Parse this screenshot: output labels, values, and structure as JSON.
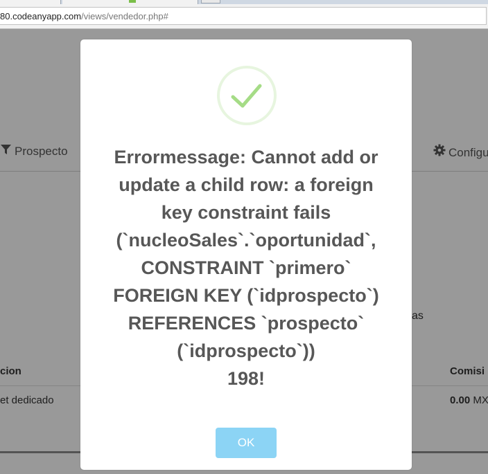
{
  "browser": {
    "url_host": "80.codeanyapp.com",
    "url_path": "/views/vendedor.php#"
  },
  "nav": {
    "items": [
      {
        "label": "Prospecto",
        "icon": "filter-icon"
      },
      {
        "label": "Configu",
        "icon": "gear-icon"
      }
    ]
  },
  "page": {
    "side_text": "as",
    "table": {
      "headers": [
        "cion",
        "Comisi"
      ],
      "row": {
        "col1": "et dedicado",
        "amount": "0.00",
        "currency": "MX"
      }
    }
  },
  "modal": {
    "icon": "checkmark-icon",
    "title_lines": [
      "Errormessage: Cannot add or",
      "update a child row: a foreign",
      "key constraint fails",
      "(`nucleoSales`.`oportunidad`,",
      "CONSTRAINT `primero`",
      "FOREIGN KEY (`idprospecto`)",
      "REFERENCES `prospecto`",
      "(`idprospecto`))",
      "198!"
    ],
    "ok_label": "OK"
  },
  "colors": {
    "ok_button": "#8cd4f5",
    "success_green": "#a5dc86",
    "overlay": "rgba(0,0,0,0.40)"
  }
}
